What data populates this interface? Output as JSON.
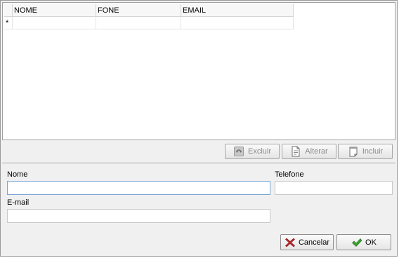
{
  "grid": {
    "columns": [
      "NOME",
      "FONE",
      "EMAIL"
    ],
    "new_row_marker": "*"
  },
  "toolbar": {
    "excluir_label": "Excluir",
    "alterar_label": "Alterar",
    "incluir_label": "Incluir"
  },
  "form": {
    "nome_label": "Nome",
    "nome_value": "",
    "telefone_label": "Telefone",
    "telefone_value": "",
    "email_label": "E-mail",
    "email_value": ""
  },
  "footer": {
    "cancel_label": "Cancelar",
    "ok_label": "OK"
  },
  "colors": {
    "cancel_icon": "#c0282d",
    "ok_icon": "#3aa42f",
    "focus_border": "#7aa5d6"
  },
  "icons": {
    "excluir": "recycle-bin-icon",
    "alterar": "document-edit-icon",
    "incluir": "new-document-icon",
    "cancel": "red-x-icon",
    "ok": "green-check-icon"
  }
}
